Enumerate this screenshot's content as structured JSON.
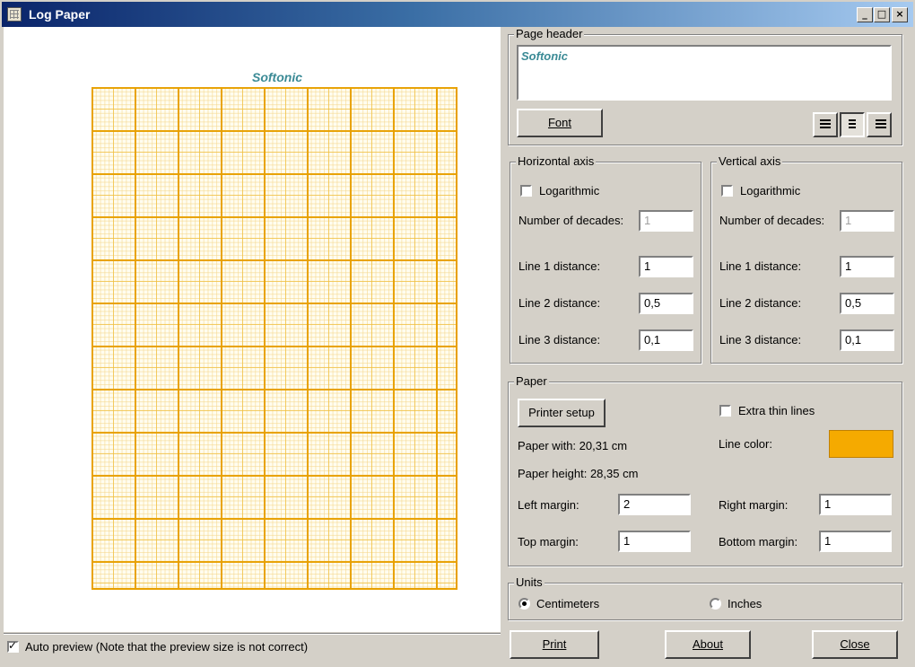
{
  "window": {
    "title": "Log Paper",
    "minimize": "_",
    "maximize": "□",
    "close": "×"
  },
  "preview": {
    "header_text": "Softonic"
  },
  "page_header": {
    "legend": "Page header",
    "text": "Softonic",
    "font_button": "Font",
    "align_left_icon": "align-left-icon",
    "align_center_icon": "align-center-icon",
    "align_right_icon": "align-right-icon"
  },
  "horizontal_axis": {
    "legend": "Horizontal axis",
    "logarithmic_label": "Logarithmic",
    "logarithmic": false,
    "decades_label": "Number of decades:",
    "decades_value": "1",
    "line1_label": "Line 1 distance:",
    "line1_value": "1",
    "line2_label": "Line 2 distance:",
    "line2_value": "0,5",
    "line3_label": "Line 3 distance:",
    "line3_value": "0,1"
  },
  "vertical_axis": {
    "legend": "Vertical axis",
    "logarithmic_label": "Logarithmic",
    "logarithmic": false,
    "decades_label": "Number of decades:",
    "decades_value": "1",
    "line1_label": "Line 1 distance:",
    "line1_value": "1",
    "line2_label": "Line 2 distance:",
    "line2_value": "0,5",
    "line3_label": "Line 3 distance:",
    "line3_value": "0,1"
  },
  "paper": {
    "legend": "Paper",
    "printer_setup_button": "Printer setup",
    "extra_thin_lines_label": "Extra thin lines",
    "extra_thin_lines": false,
    "paper_width_text": "Paper with: 20,31 cm",
    "paper_height_text": "Paper height: 28,35 cm",
    "line_color_label": "Line color:",
    "line_color": "#f5aa00",
    "left_margin_label": "Left margin:",
    "left_margin_value": "2",
    "right_margin_label": "Right margin:",
    "right_margin_value": "1",
    "top_margin_label": "Top margin:",
    "top_margin_value": "1",
    "bottom_margin_label": "Bottom margin:",
    "bottom_margin_value": "1"
  },
  "units": {
    "legend": "Units",
    "centimeters_label": "Centimeters",
    "inches_label": "Inches",
    "selected": "Centimeters"
  },
  "auto_preview": {
    "label": "Auto preview (Note that the preview size is not correct)",
    "checked": true
  },
  "buttons": {
    "print": "Print",
    "about": "About",
    "close": "Close"
  }
}
